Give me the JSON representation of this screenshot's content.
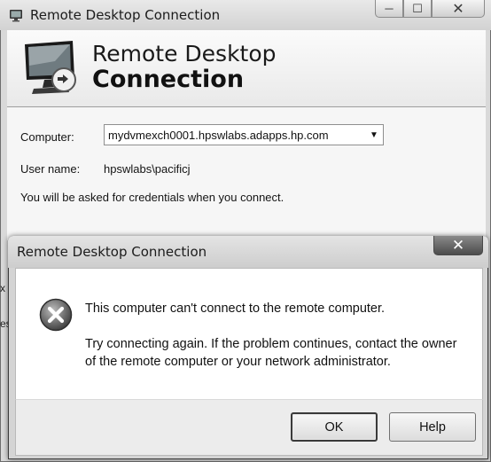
{
  "main_window": {
    "title": "Remote Desktop Connection",
    "header_line1": "Remote Desktop",
    "header_line2": "Connection",
    "computer_label": "Computer:",
    "computer_value": "mydvmexch0001.hpswlabs.adapps.hp.com",
    "username_label": "User name:",
    "username_value": "hpswlabs\\pacificj",
    "credentials_note": "You will be asked for credentials when you connect.",
    "edge_text_1": "x",
    "edge_text_2": "es",
    "controls": {
      "minimize_icon": "minimize-icon",
      "maximize_icon": "maximize-icon",
      "close_icon": "close-icon"
    }
  },
  "error_dialog": {
    "title": "Remote Desktop Connection",
    "close_glyph": "✕",
    "message": "This computer can't connect to the remote computer.",
    "detail": "Try connecting again. If the problem continues, contact the owner of the remote computer or your network administrator.",
    "ok_label": "OK",
    "help_label": "Help",
    "icon": "error-icon"
  }
}
